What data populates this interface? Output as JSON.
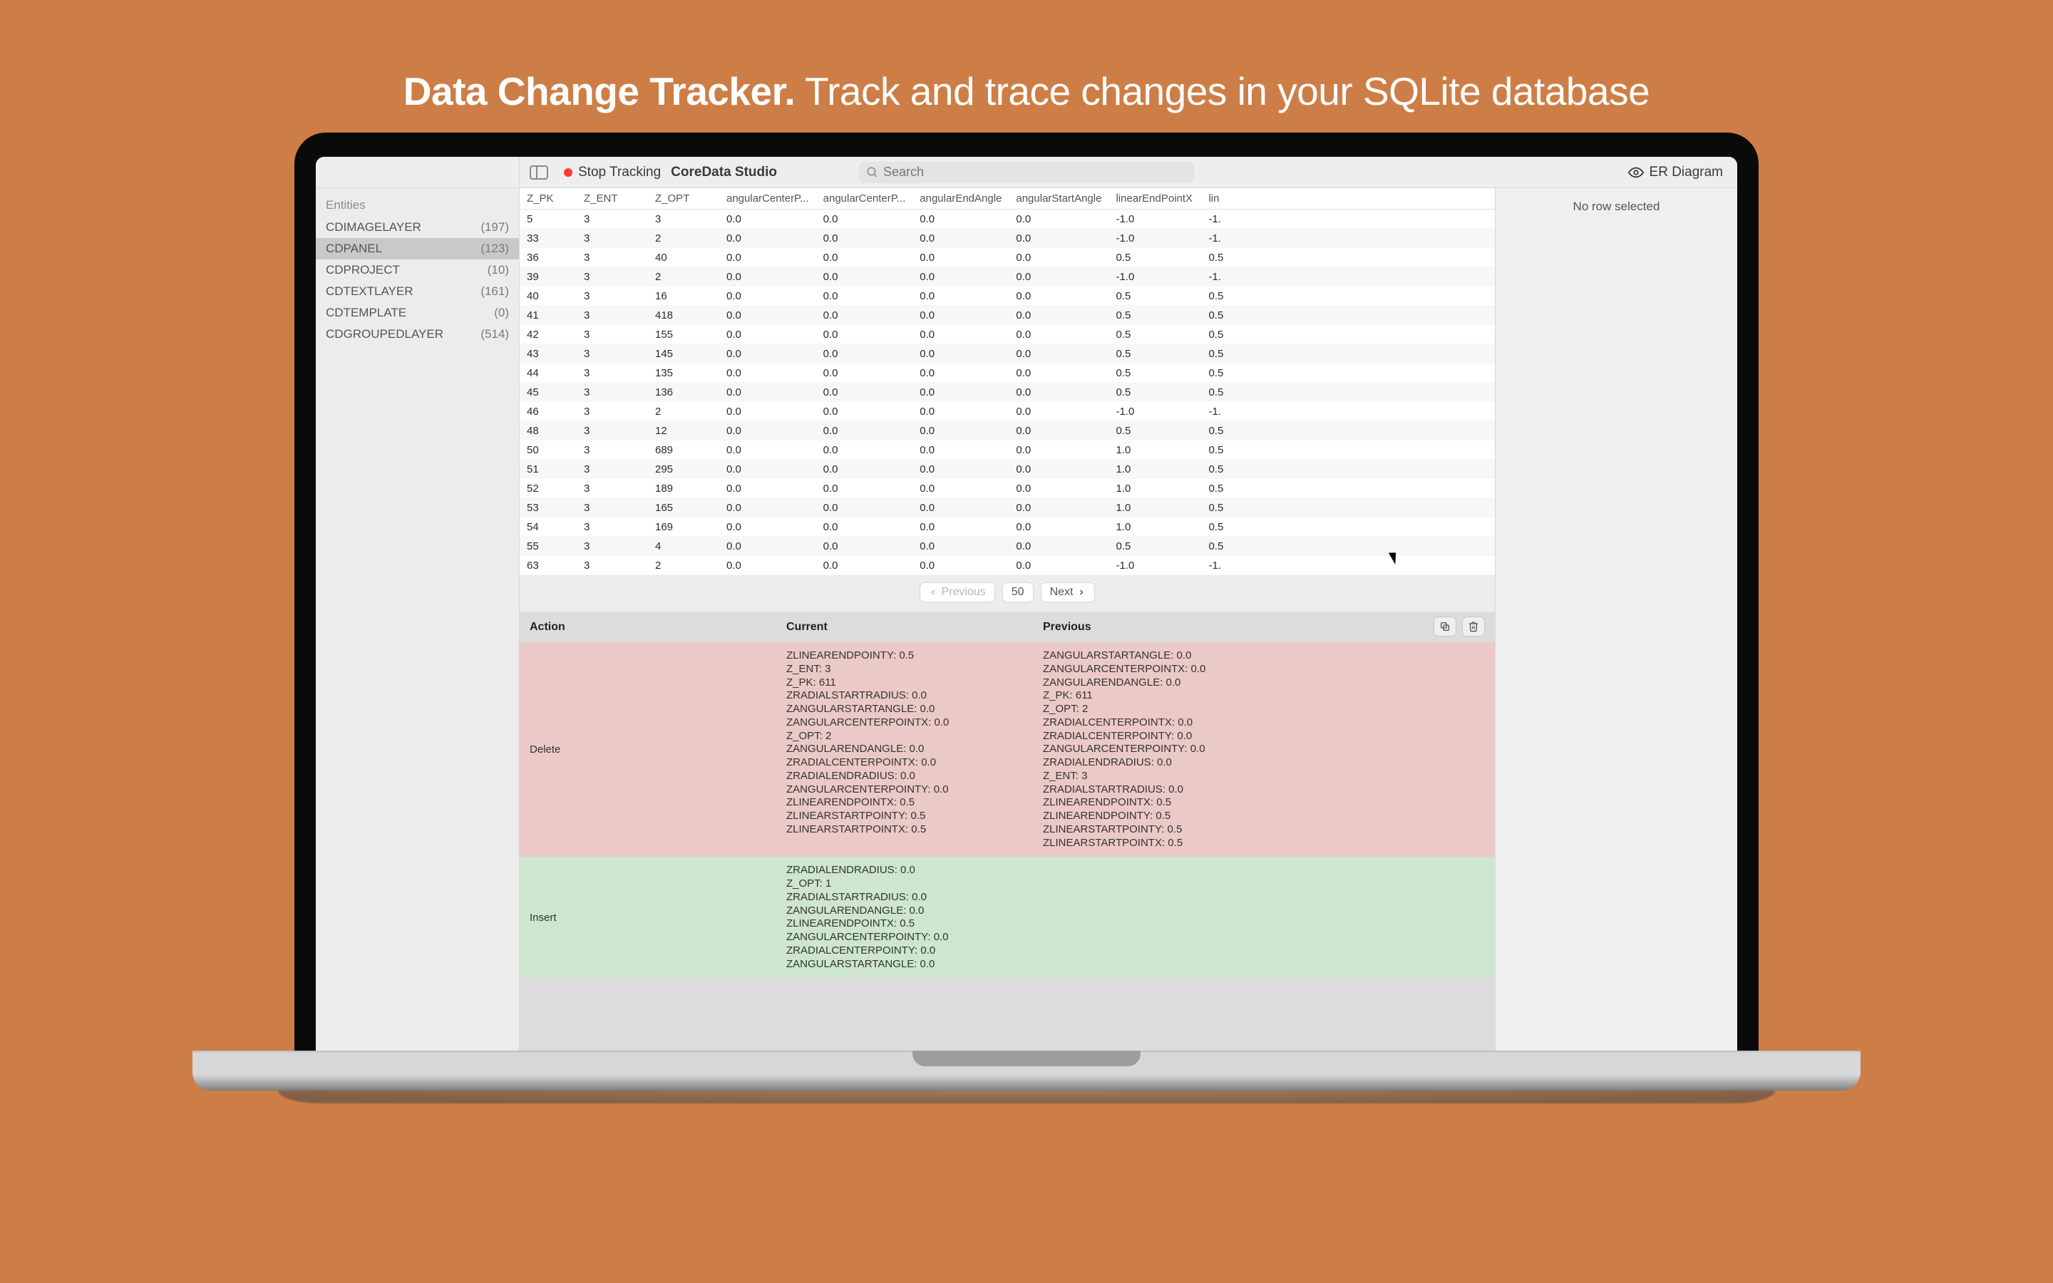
{
  "hero": {
    "bold": "Data Change Tracker.",
    "rest": " Track and trace changes in your SQLite database"
  },
  "toolbar": {
    "stop_tracking": "Stop Tracking",
    "app_title": "CoreData Studio",
    "search_placeholder": "Search",
    "er_diagram": "ER Diagram"
  },
  "sidebar": {
    "header": "Entities",
    "items": [
      {
        "name": "CDIMAGELAYER",
        "count": "(197)",
        "selected": false
      },
      {
        "name": "CDPANEL",
        "count": "(123)",
        "selected": true
      },
      {
        "name": "CDPROJECT",
        "count": "(10)",
        "selected": false
      },
      {
        "name": "CDTEXTLAYER",
        "count": "(161)",
        "selected": false
      },
      {
        "name": "CDTEMPLATE",
        "count": "(0)",
        "selected": false
      },
      {
        "name": "CDGROUPEDLAYER",
        "count": "(514)",
        "selected": false
      }
    ]
  },
  "table": {
    "columns": [
      "Z_PK",
      "Z_ENT",
      "Z_OPT",
      "angularCenterP...",
      "angularCenterP...",
      "angularEndAngle",
      "angularStartAngle",
      "linearEndPointX",
      "lin"
    ],
    "rows": [
      [
        "5",
        "3",
        "3",
        "0.0",
        "0.0",
        "0.0",
        "0.0",
        "-1.0",
        "-1."
      ],
      [
        "33",
        "3",
        "2",
        "0.0",
        "0.0",
        "0.0",
        "0.0",
        "-1.0",
        "-1."
      ],
      [
        "36",
        "3",
        "40",
        "0.0",
        "0.0",
        "0.0",
        "0.0",
        "0.5",
        "0.5"
      ],
      [
        "39",
        "3",
        "2",
        "0.0",
        "0.0",
        "0.0",
        "0.0",
        "-1.0",
        "-1."
      ],
      [
        "40",
        "3",
        "16",
        "0.0",
        "0.0",
        "0.0",
        "0.0",
        "0.5",
        "0.5"
      ],
      [
        "41",
        "3",
        "418",
        "0.0",
        "0.0",
        "0.0",
        "0.0",
        "0.5",
        "0.5"
      ],
      [
        "42",
        "3",
        "155",
        "0.0",
        "0.0",
        "0.0",
        "0.0",
        "0.5",
        "0.5"
      ],
      [
        "43",
        "3",
        "145",
        "0.0",
        "0.0",
        "0.0",
        "0.0",
        "0.5",
        "0.5"
      ],
      [
        "44",
        "3",
        "135",
        "0.0",
        "0.0",
        "0.0",
        "0.0",
        "0.5",
        "0.5"
      ],
      [
        "45",
        "3",
        "136",
        "0.0",
        "0.0",
        "0.0",
        "0.0",
        "0.5",
        "0.5"
      ],
      [
        "46",
        "3",
        "2",
        "0.0",
        "0.0",
        "0.0",
        "0.0",
        "-1.0",
        "-1."
      ],
      [
        "48",
        "3",
        "12",
        "0.0",
        "0.0",
        "0.0",
        "0.0",
        "0.5",
        "0.5"
      ],
      [
        "50",
        "3",
        "689",
        "0.0",
        "0.0",
        "0.0",
        "0.0",
        "1.0",
        "0.5"
      ],
      [
        "51",
        "3",
        "295",
        "0.0",
        "0.0",
        "0.0",
        "0.0",
        "1.0",
        "0.5"
      ],
      [
        "52",
        "3",
        "189",
        "0.0",
        "0.0",
        "0.0",
        "0.0",
        "1.0",
        "0.5"
      ],
      [
        "53",
        "3",
        "165",
        "0.0",
        "0.0",
        "0.0",
        "0.0",
        "1.0",
        "0.5"
      ],
      [
        "54",
        "3",
        "169",
        "0.0",
        "0.0",
        "0.0",
        "0.0",
        "1.0",
        "0.5"
      ],
      [
        "55",
        "3",
        "4",
        "0.0",
        "0.0",
        "0.0",
        "0.0",
        "0.5",
        "0.5"
      ],
      [
        "63",
        "3",
        "2",
        "0.0",
        "0.0",
        "0.0",
        "0.0",
        "-1.0",
        "-1."
      ]
    ]
  },
  "pager": {
    "previous": "Previous",
    "page_size": "50",
    "next": "Next"
  },
  "changes": {
    "headers": {
      "action": "Action",
      "current": "Current",
      "previous": "Previous"
    },
    "rows": [
      {
        "type": "delete",
        "action": "Delete",
        "current": "ZLINEARENDPOINTY: 0.5\nZ_ENT: 3\nZ_PK: 611\nZRADIALSTARTRADIUS: 0.0\nZANGULARSTARTANGLE: 0.0\nZANGULARCENTERPOINTX: 0.0\nZ_OPT: 2\nZANGULARENDANGLE: 0.0\nZRADIALCENTERPOINTX: 0.0\nZRADIALENDRADIUS: 0.0\nZANGULARCENTERPOINTY: 0.0\nZLINEARENDPOINTX: 0.5\nZLINEARSTARTPOINTY: 0.5\nZLINEARSTARTPOINTX: 0.5",
        "previous": "ZANGULARSTARTANGLE: 0.0\nZANGULARCENTERPOINTX: 0.0\nZANGULARENDANGLE: 0.0\nZ_PK: 611\nZ_OPT: 2\nZRADIALCENTERPOINTX: 0.0\nZRADIALCENTERPOINTY: 0.0\nZANGULARCENTERPOINTY: 0.0\nZRADIALENDRADIUS: 0.0\nZ_ENT: 3\nZRADIALSTARTRADIUS: 0.0\nZLINEARENDPOINTX: 0.5\nZLINEARENDPOINTY: 0.5\nZLINEARSTARTPOINTY: 0.5\nZLINEARSTARTPOINTX: 0.5"
      },
      {
        "type": "insert",
        "action": "Insert",
        "current": "ZRADIALENDRADIUS: 0.0\nZ_OPT: 1\nZRADIALSTARTRADIUS: 0.0\nZANGULARENDANGLE: 0.0\nZLINEARENDPOINTX: 0.5\nZANGULARCENTERPOINTY: 0.0\nZRADIALCENTERPOINTY: 0.0\nZANGULARSTARTANGLE: 0.0",
        "previous": ""
      }
    ]
  },
  "inspector": {
    "no_row": "No row selected"
  }
}
